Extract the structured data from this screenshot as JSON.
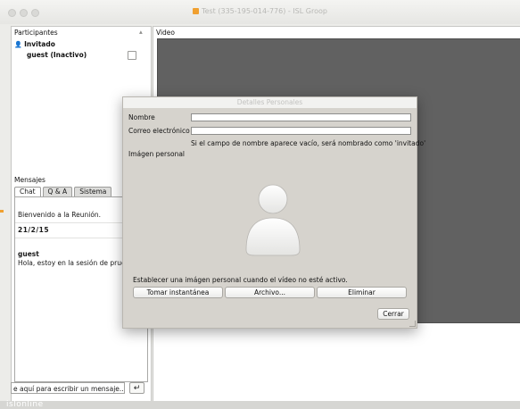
{
  "window": {
    "title": "Test (335-195-014-776) - ISL Groop"
  },
  "participants": {
    "header": "Participantes",
    "role": "Invitado",
    "guest": "guest (Inactivo)"
  },
  "video": {
    "header": "Video"
  },
  "messages": {
    "header": "Mensajes",
    "tabs": [
      "Chat",
      "Q & A",
      "Sistema"
    ],
    "welcome": "Bienvenido a la Reunión.",
    "date": "21/2/15",
    "sender": "guest",
    "text": "Hola, estoy en la sesión de pruel",
    "input_value": "e aquí para escribir un mensaje..."
  },
  "dialog": {
    "title": "Detalles Personales",
    "name_label": "Nombre",
    "email_label": "Correo electrónico",
    "hint": "Si el campo de nombre aparece vacío, será nombrado como 'invitado'",
    "image_label": "Imágen personal",
    "set_image_text": "Establecer una imágen personal cuando el vídeo no esté activo.",
    "snapshot_button": "Tomar instantánea",
    "file_button": "Archivo...",
    "delete_button": "Eliminar",
    "close_button": "Cerrar"
  },
  "brand": "islonline"
}
